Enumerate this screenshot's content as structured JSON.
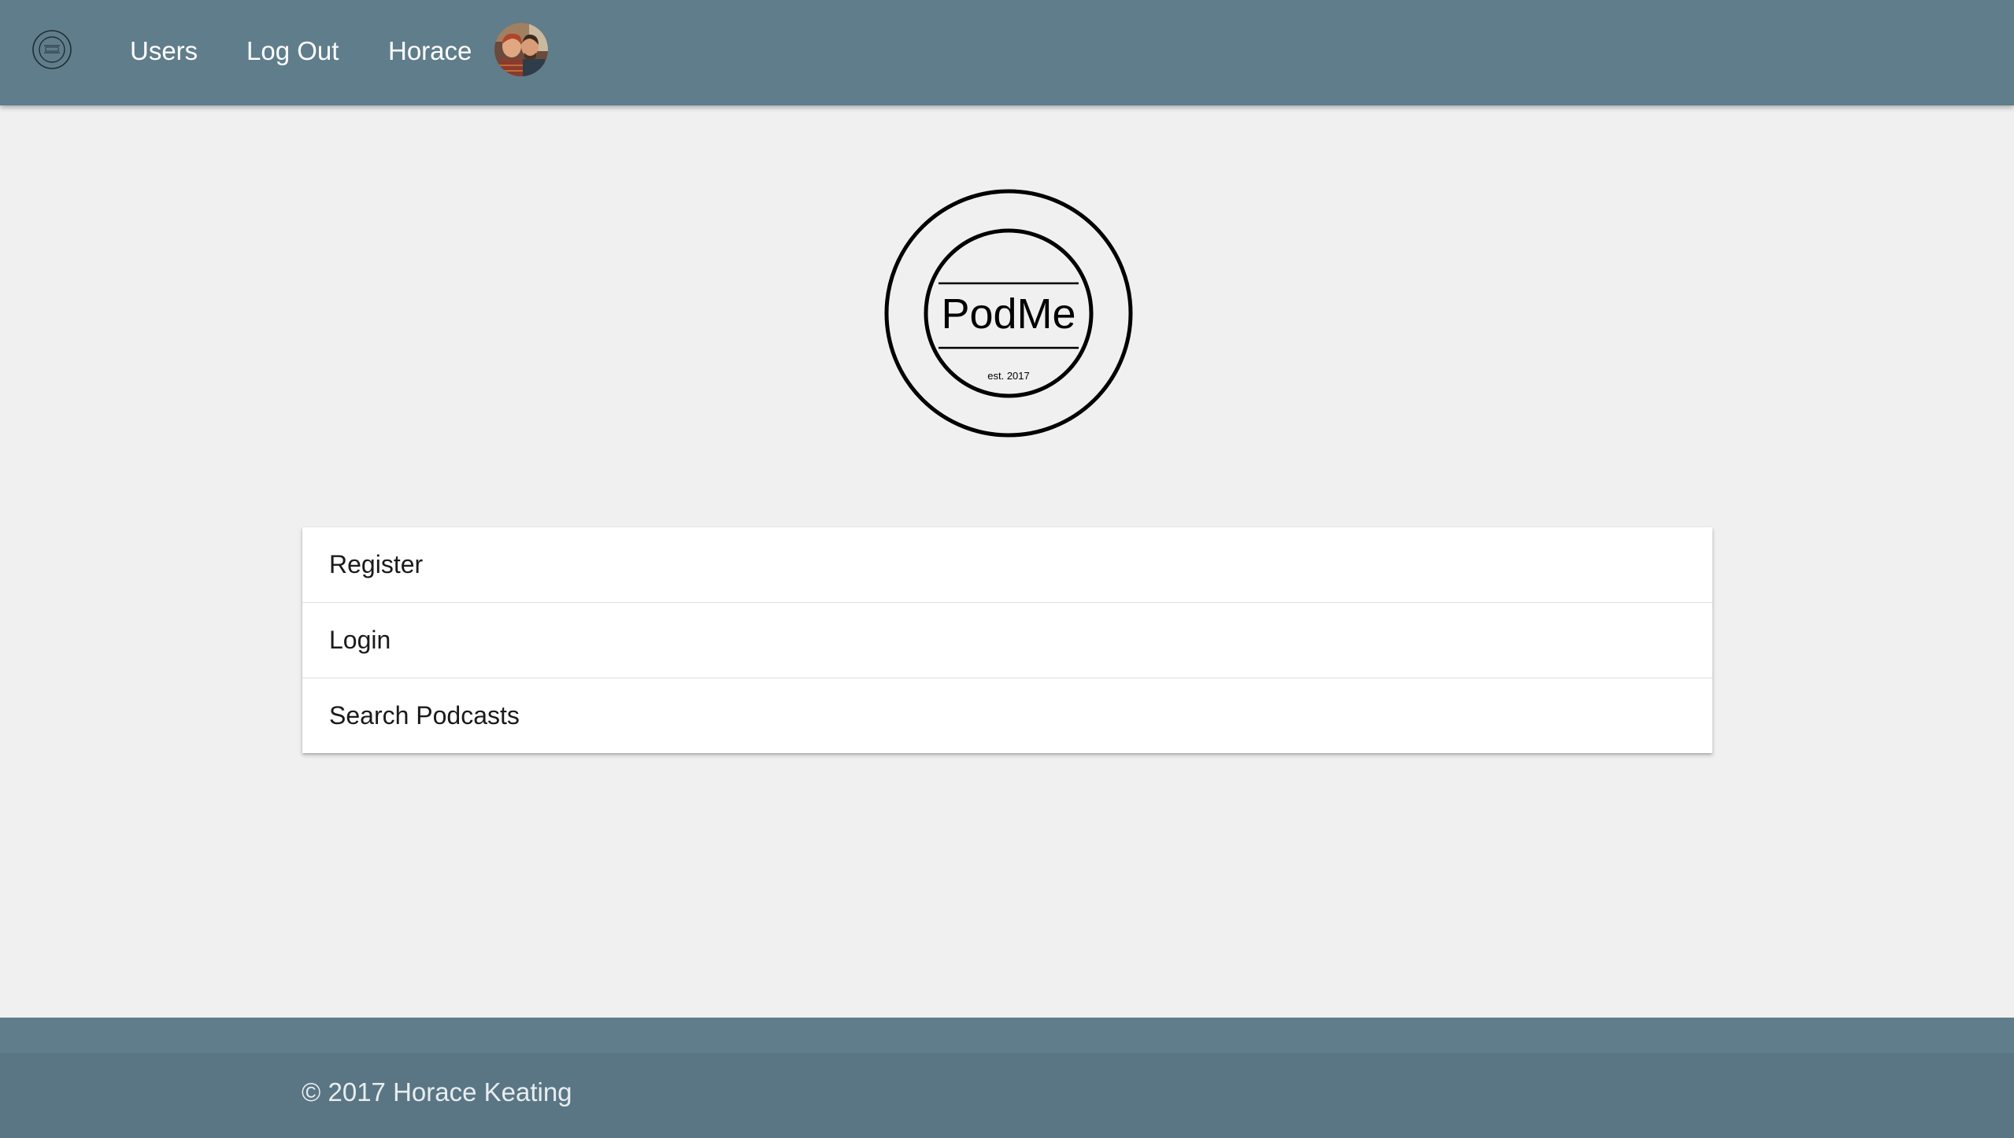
{
  "navbar": {
    "logo_icon": "podme-logo-icon",
    "links": {
      "users": "Users",
      "logout": "Log Out",
      "user_name": "Horace"
    },
    "avatar_icon": "user-avatar-photo",
    "color": "#607d8b"
  },
  "hero": {
    "logo_icon": "podme-logo",
    "logo_text": "PodMe",
    "logo_subtext": "est. 2017"
  },
  "menu": {
    "items": [
      "Register",
      "Login",
      "Search Podcasts"
    ]
  },
  "footer": {
    "copyright": "© 2017 Horace Keating",
    "color": "#607d8b"
  }
}
